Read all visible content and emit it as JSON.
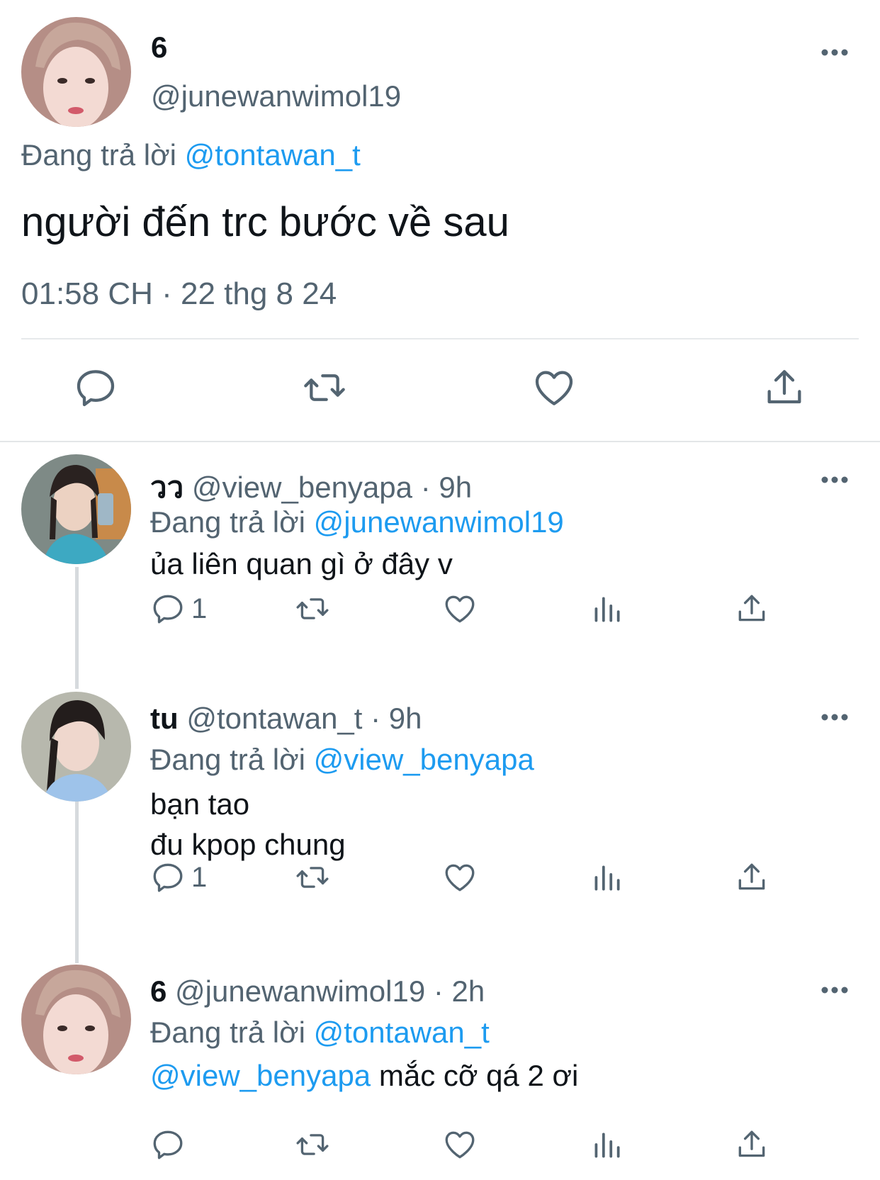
{
  "main_tweet": {
    "name": "6",
    "handle": "@junewanwimol19",
    "replying_prefix": "Đang trả lời",
    "replying_to": "@tontawan_t",
    "text": "người đến trc bước về sau",
    "timestamp": "01:58 CH · 22 thg 8 24",
    "actions": [
      "reply-icon",
      "retweet-icon",
      "like-icon",
      "share-icon"
    ]
  },
  "replies": [
    {
      "name": "วว",
      "handle": "@view_benyapa",
      "time": "· 9h",
      "replying_prefix": "Đang trả lời",
      "replying_to": "@junewanwimol19",
      "lines": [
        "ủa liên quan gì ở đây v"
      ],
      "reply_count": "1"
    },
    {
      "name": "tu",
      "handle": "@tontawan_t",
      "time": "· 9h",
      "replying_prefix": "Đang trả lời",
      "replying_to": "@view_benyapa",
      "lines": [
        "bạn tao",
        "đu kpop chung"
      ],
      "reply_count": "1"
    },
    {
      "name": "6",
      "handle": "@junewanwimol19",
      "time": "· 2h",
      "replying_prefix": "Đang trả lời",
      "replying_to": "@tontawan_t",
      "mention": "@view_benyapa",
      "text": "mắc cỡ qá 2 ơi",
      "reply_count": ""
    }
  ],
  "colors": {
    "link": "#1d9bf0",
    "secondary_text": "#536471",
    "primary_text": "#0f1419",
    "thread_line": "#d6dadd"
  }
}
